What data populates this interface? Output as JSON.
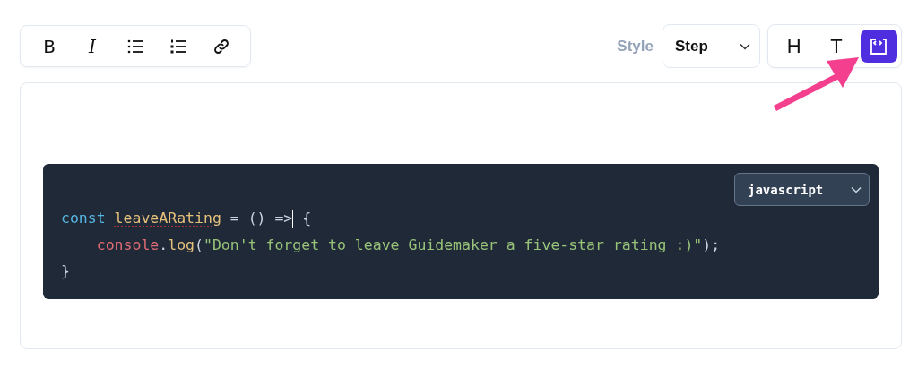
{
  "format_toolbar": [
    {
      "kind": "bold",
      "label": "B"
    },
    {
      "kind": "italic",
      "label": "I"
    },
    {
      "kind": "bullet-list"
    },
    {
      "kind": "numbered-list"
    },
    {
      "kind": "link"
    }
  ],
  "style_label": "Style",
  "style_select": {
    "value": "Step"
  },
  "block_types": [
    {
      "kind": "text",
      "label": "H",
      "selected": false
    },
    {
      "kind": "text",
      "label": "T",
      "selected": false
    },
    {
      "kind": "code",
      "selected": true
    }
  ],
  "code_block": {
    "language": "javascript",
    "lines": [
      [
        {
          "kind": "keyword",
          "text": "const "
        },
        {
          "kind": "variable",
          "text": "leaveARating",
          "misspelled": true
        },
        {
          "kind": "plain",
          "text": " = () =>"
        },
        {
          "kind": "cursor"
        },
        {
          "kind": "plain",
          "text": " {"
        }
      ],
      [
        {
          "kind": "indent"
        },
        {
          "kind": "object",
          "text": "console"
        },
        {
          "kind": "plain",
          "text": "."
        },
        {
          "kind": "function",
          "text": "log"
        },
        {
          "kind": "plain",
          "text": "("
        },
        {
          "kind": "string",
          "text": "\"Don't forget to leave Guidemaker a five-star rating :)\""
        },
        {
          "kind": "plain",
          "text": ");"
        }
      ],
      [
        {
          "kind": "plain",
          "text": "}"
        }
      ]
    ]
  }
}
